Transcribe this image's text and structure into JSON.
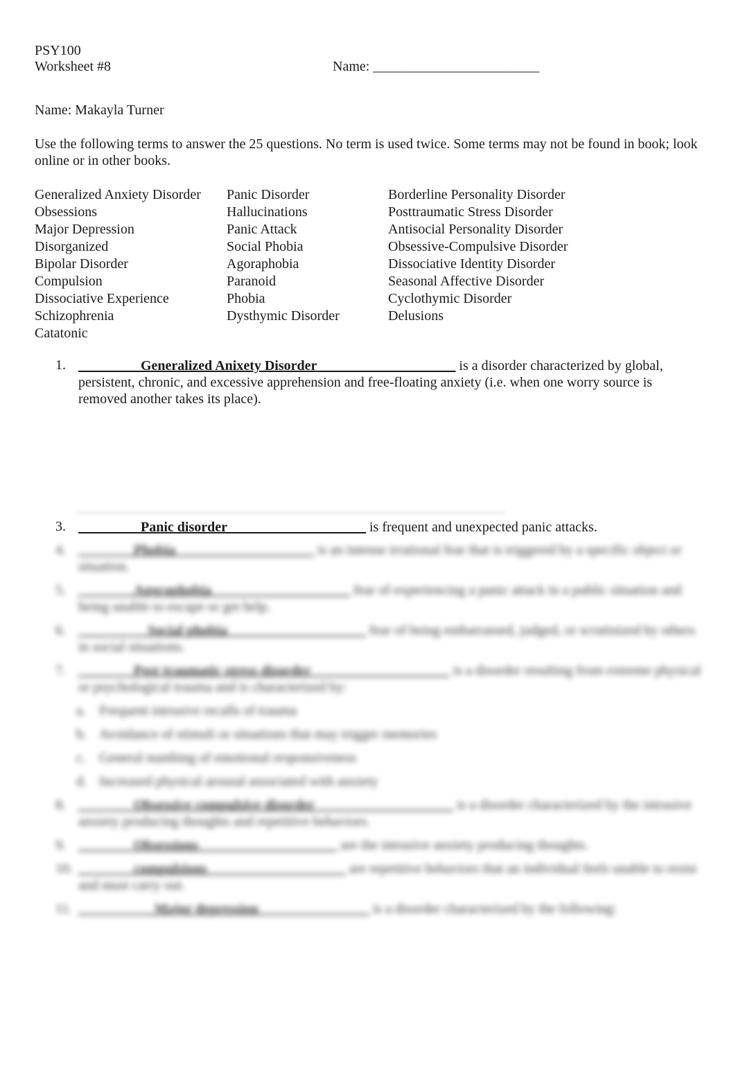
{
  "header": {
    "course": "PSY100",
    "worksheet": "Worksheet #8",
    "name_label": "Name: ________________________"
  },
  "student_name": "Name: Makayla Turner",
  "instructions": "Use the following terms to answer the 25 questions. No term is used twice. Some terms may not be found in book; look online or in other books.",
  "terms": {
    "column1": [
      "Generalized Anxiety Disorder",
      "Obsessions",
      "Major Depression",
      "Disorganized",
      "Bipolar Disorder",
      "Compulsion",
      "Dissociative Experience",
      "Schizophrenia",
      "Catatonic"
    ],
    "column2": [
      "Panic Disorder",
      "Hallucinations",
      "Panic Attack",
      "Social Phobia",
      "Agoraphobia",
      "Paranoid",
      "Phobia",
      "Dysthymic Disorder"
    ],
    "column3": [
      "Borderline Personality Disorder",
      "Posttraumatic Stress Disorder",
      "Antisocial Personality Disorder",
      "Obsessive-Compulsive Disorder",
      "Dissociative Identity Disorder",
      "Seasonal Affective Disorder",
      "Cyclothymic Disorder",
      "Delusions"
    ]
  },
  "questions": [
    {
      "number": "1.",
      "blank_before": "_________",
      "answer": "Generalized Anixety Disorder",
      "blank_after": "____________________",
      "text": " is a disorder characterized by global, persistent, chronic, and excessive apprehension and free-floating anxiety (i.e. when one worry source is removed another takes its place)."
    },
    {
      "number": "3.",
      "blank_before": "_______",
      "answer": "__Panic disorder",
      "blank_after": "____________________",
      "text": " is frequent and unexpected panic attacks."
    }
  ],
  "blurred_questions": [
    {
      "number": "4.",
      "answer": "________Phobia____________________",
      "text": " is an intense irrational fear that is triggered by a specific object or situation."
    },
    {
      "number": "5.",
      "answer": "________Agoraphobia____________________",
      "text": " fear of experiencing a panic attack in a public situation and being unable to escape or get help."
    },
    {
      "number": "6.",
      "answer": "__________Social phobia____________________",
      "text": " fear of being embarrassed, judged, or scrutinized by others in social situations."
    },
    {
      "number": "7.",
      "answer": "________Post traumatic stress disorder____________________",
      "text": " is a disorder resulting from extreme physical or psychological trauma and is characterized by:"
    }
  ],
  "blurred_subitems": [
    {
      "number": "a.",
      "text": "Frequent intrusive recalls of trauma"
    },
    {
      "number": "b.",
      "text": "Avoidance of stimuli or situations that may trigger memories"
    },
    {
      "number": "c.",
      "text": "General numbing of emotional responsiveness"
    },
    {
      "number": "d.",
      "text": "Increased physical arousal associated with anxiety"
    }
  ],
  "blurred_questions_2": [
    {
      "number": "8.",
      "answer": "________Obsessive compulsive disorder____________________",
      "text": " is a disorder characterized by the intrusive anxiety producing thoughts and repetitive behaviors."
    },
    {
      "number": "9.",
      "answer": "________Obsessions____________________",
      "text": " are the intrusive anxiety producing thoughts."
    },
    {
      "number": "10.",
      "answer": "________compulsions____________________",
      "text": " are repetitive behaviors that an individual feels unable to resist and must carry out."
    },
    {
      "number": "11.",
      "answer": "___________Major depression________________",
      "text": " is a disorder characterized by the following:"
    }
  ]
}
